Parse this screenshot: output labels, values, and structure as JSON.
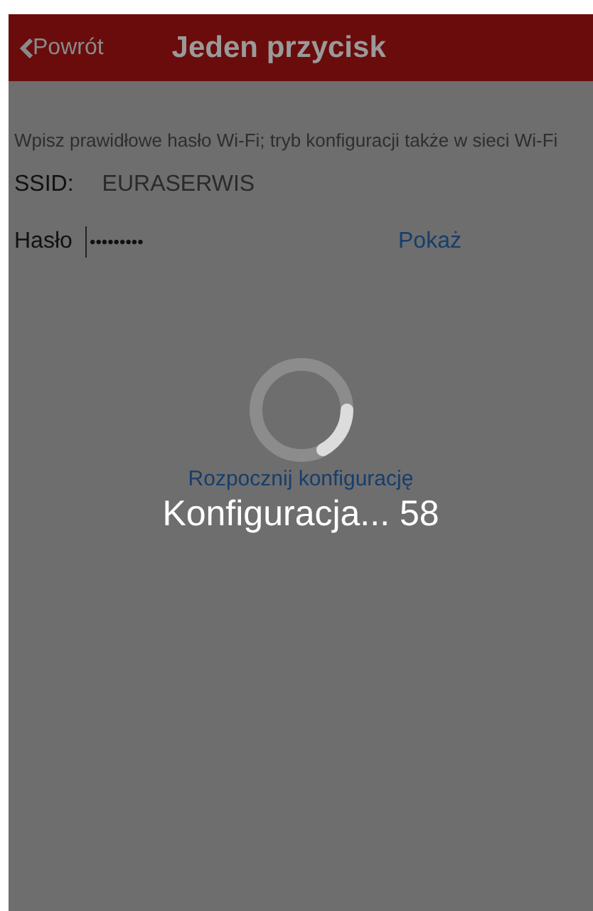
{
  "nav_bar": {
    "back": "Powrót",
    "title": "Jeden przycisk"
  },
  "description": "Wpisz prawidłowe hasło Wi-Fi; tryb konfiguracji także w sieci Wi-Fi",
  "ssid": {
    "label": "SSID:",
    "value": "EURASERWIS"
  },
  "password": {
    "label": "Hasło",
    "value": "•••••••••",
    "toggle": "Pokaż"
  },
  "start_button": "Rozpocznij konfigurację",
  "progress": {
    "text": "Konfiguracja... 58"
  }
}
